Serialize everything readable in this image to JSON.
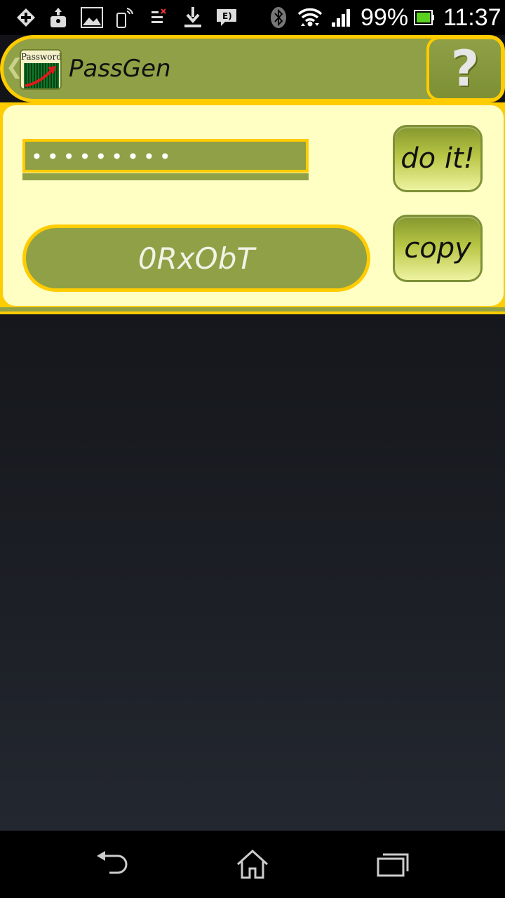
{
  "status_bar": {
    "icons_left": [
      "add-icon",
      "upload-lock-icon",
      "gallery-icon",
      "phone-signal-icon",
      "task-list-icon",
      "download-icon",
      "message-icon"
    ],
    "icons_right": [
      "bluetooth-icon",
      "wifi-icon",
      "signal-icon",
      "battery-icon"
    ],
    "battery_percent": "99%",
    "time": "11:37"
  },
  "action_bar": {
    "logo_text": "Password",
    "title": "PassGen",
    "help_label": "?"
  },
  "main": {
    "password_mask": "•••••••••",
    "result": "0RxObT",
    "do_it_label": "do it!",
    "copy_label": "copy"
  },
  "colors": {
    "accent_yellow": "#ffcc00",
    "olive": "#8fa046",
    "panel_bg": "#ffffc4"
  },
  "nav_bar": {
    "buttons": [
      "back-icon",
      "home-icon",
      "recents-icon"
    ]
  }
}
